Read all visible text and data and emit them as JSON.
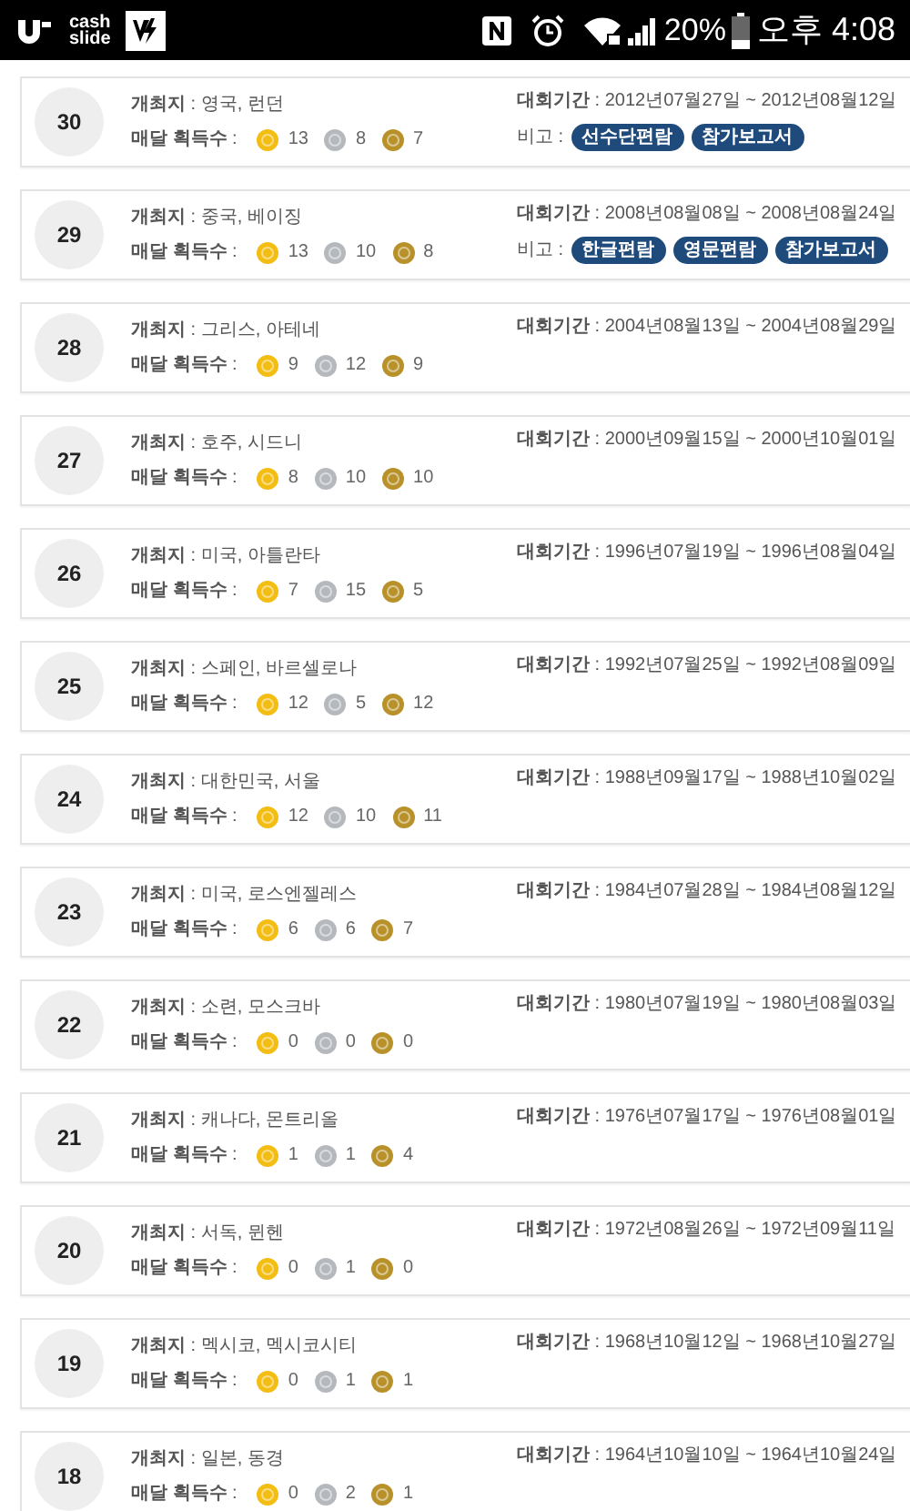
{
  "status_bar": {
    "app_label": "cash\nslide",
    "battery": "20%",
    "time": "오후 4:08"
  },
  "games": [
    {
      "number": "30",
      "venue": "**개최지** : 영국, 런던",
      "medals_label": "**매달 획득수** :",
      "medals": [
        {
          "kind": "gold",
          "count": "13"
        },
        {
          "kind": "silver",
          "count": "8"
        },
        {
          "kind": "bronze",
          "count": "7"
        }
      ],
      "period": "**대회기간** : 2012년07월27일 ~ 2012년08월12일",
      "notes_label": "비고 :",
      "notes": [
        "선수단편람",
        "참가보고서"
      ]
    },
    {
      "number": "29",
      "venue": "**개최지** : 중국, 베이징",
      "medals_label": "**매달 획득수** :",
      "medals": [
        {
          "kind": "gold",
          "count": "13"
        },
        {
          "kind": "silver",
          "count": "10"
        },
        {
          "kind": "bronze",
          "count": "8"
        }
      ],
      "period": "**대회기간** : 2008년08월08일 ~ 2008년08월24일",
      "notes_label": "비고 :",
      "notes": [
        "한글편람",
        "영문편람",
        "참가보고서"
      ]
    },
    {
      "number": "28",
      "venue": "**개최지** : 그리스, 아테네",
      "medals_label": "**매달 획득수** :",
      "medals": [
        {
          "kind": "gold",
          "count": "9"
        },
        {
          "kind": "silver",
          "count": "12"
        },
        {
          "kind": "bronze",
          "count": "9"
        }
      ],
      "period": "**대회기간** : 2004년08월13일 ~ 2004년08월29일"
    },
    {
      "number": "27",
      "venue": "**개최지** : 호주, 시드니",
      "medals_label": "**매달 획득수** :",
      "medals": [
        {
          "kind": "gold",
          "count": "8"
        },
        {
          "kind": "silver",
          "count": "10"
        },
        {
          "kind": "bronze",
          "count": "10"
        }
      ],
      "period": "**대회기간** : 2000년09월15일 ~ 2000년10월01일"
    },
    {
      "number": "26",
      "venue": "**개최지** : 미국, 아틀란타",
      "medals_label": "**매달 획득수** :",
      "medals": [
        {
          "kind": "gold",
          "count": "7"
        },
        {
          "kind": "silver",
          "count": "15"
        },
        {
          "kind": "bronze",
          "count": "5"
        }
      ],
      "period": "**대회기간** : 1996년07월19일 ~ 1996년08월04일"
    },
    {
      "number": "25",
      "venue": "**개최지** : 스페인, 바르셀로나",
      "medals_label": "**매달 획득수** :",
      "medals": [
        {
          "kind": "gold",
          "count": "12"
        },
        {
          "kind": "silver",
          "count": "5"
        },
        {
          "kind": "bronze",
          "count": "12"
        }
      ],
      "period": "**대회기간** : 1992년07월25일 ~ 1992년08월09일"
    },
    {
      "number": "24",
      "venue": "**개최지** : 대한민국, 서울",
      "medals_label": "**매달 획득수** :",
      "medals": [
        {
          "kind": "gold",
          "count": "12"
        },
        {
          "kind": "silver",
          "count": "10"
        },
        {
          "kind": "bronze",
          "count": "11"
        }
      ],
      "period": "**대회기간** : 1988년09월17일 ~ 1988년10월02일"
    },
    {
      "number": "23",
      "venue": "**개최지** : 미국, 로스엔젤레스",
      "medals_label": "**매달 획득수** :",
      "medals": [
        {
          "kind": "gold",
          "count": "6"
        },
        {
          "kind": "silver",
          "count": "6"
        },
        {
          "kind": "bronze",
          "count": "7"
        }
      ],
      "period": "**대회기간** : 1984년07월28일 ~ 1984년08월12일"
    },
    {
      "number": "22",
      "venue": "**개최지** : 소련, 모스크바",
      "medals_label": "**매달 획득수** :",
      "medals": [
        {
          "kind": "gold",
          "count": "0"
        },
        {
          "kind": "silver",
          "count": "0"
        },
        {
          "kind": "bronze",
          "count": "0"
        }
      ],
      "period": "**대회기간** : 1980년07월19일 ~ 1980년08월03일"
    },
    {
      "number": "21",
      "venue": "**개최지** : 캐나다, 몬트리올",
      "medals_label": "**매달 획득수** :",
      "medals": [
        {
          "kind": "gold",
          "count": "1"
        },
        {
          "kind": "silver",
          "count": "1"
        },
        {
          "kind": "bronze",
          "count": "4"
        }
      ],
      "period": "**대회기간** : 1976년07월17일 ~ 1976년08월01일"
    },
    {
      "number": "20",
      "venue": "**개최지** : 서독, 뮌헨",
      "medals_label": "**매달 획득수** :",
      "medals": [
        {
          "kind": "gold",
          "count": "0"
        },
        {
          "kind": "silver",
          "count": "1"
        },
        {
          "kind": "bronze",
          "count": "0"
        }
      ],
      "period": "**대회기간** : 1972년08월26일 ~ 1972년09월11일"
    },
    {
      "number": "19",
      "venue": "**개최지** : 멕시코, 멕시코시티",
      "medals_label": "**매달 획득수** :",
      "medals": [
        {
          "kind": "gold",
          "count": "0"
        },
        {
          "kind": "silver",
          "count": "1"
        },
        {
          "kind": "bronze",
          "count": "1"
        }
      ],
      "period": "**대회기간** : 1968년10월12일 ~ 1968년10월27일"
    },
    {
      "number": "18",
      "venue": "**개최지** : 일본, 동경",
      "medals_label": "**매달 획득수** :",
      "medals": [
        {
          "kind": "gold",
          "count": "0"
        },
        {
          "kind": "silver",
          "count": "2"
        },
        {
          "kind": "bronze",
          "count": "1"
        }
      ],
      "period": "**대회기간** : 1964년10월10일 ~ 1964년10월24일"
    }
  ]
}
